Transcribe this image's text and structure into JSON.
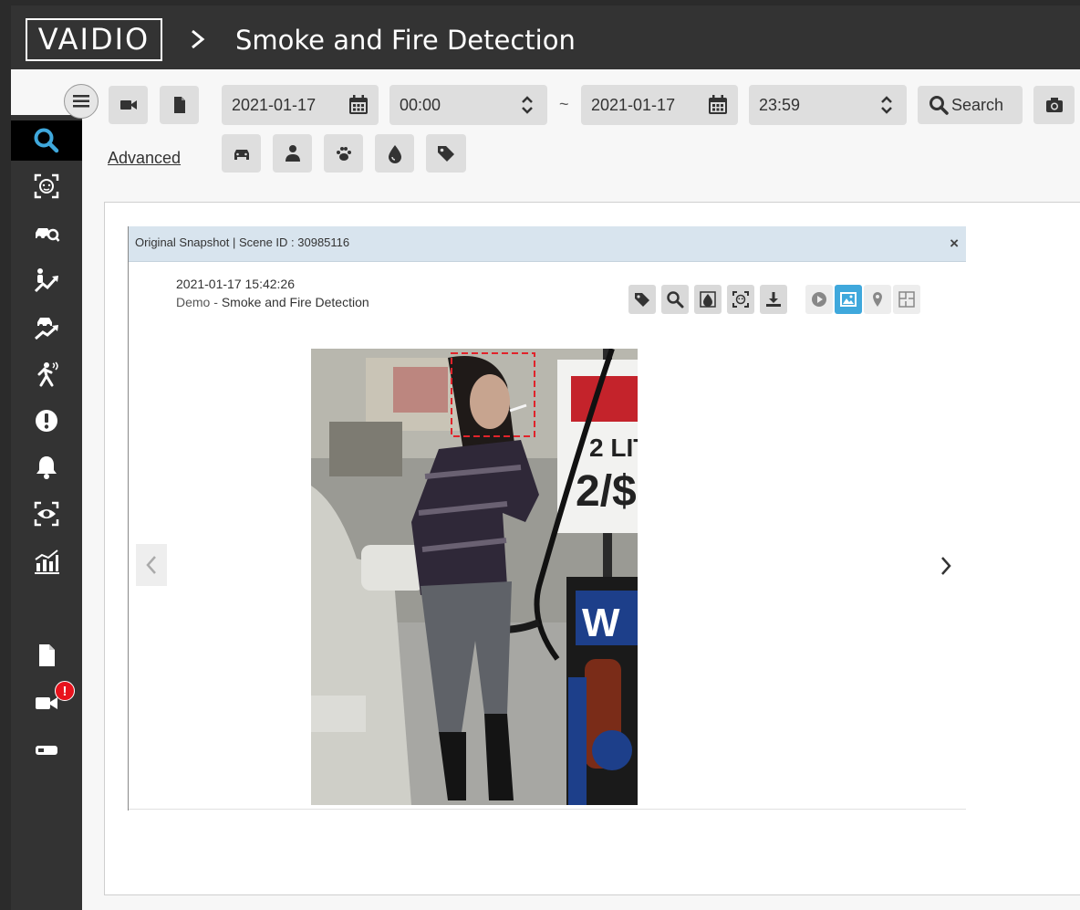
{
  "app": {
    "logo": "VAIDIO",
    "page_title": "Smoke and Fire Detection"
  },
  "toolbar": {
    "start_date": "2021-01-17",
    "start_time": "00:00",
    "range_sep": "~",
    "end_date": "2021-01-17",
    "end_time": "23:59",
    "search_label": "Search",
    "advanced_label": "Advanced"
  },
  "sidebar": {
    "items": [
      {
        "icon": "search-icon",
        "active": true
      },
      {
        "icon": "face-scan-icon"
      },
      {
        "icon": "vehicle-search-icon"
      },
      {
        "icon": "person-trend-icon"
      },
      {
        "icon": "vehicle-trend-icon"
      },
      {
        "icon": "fall-detection-icon"
      },
      {
        "icon": "alert-icon"
      },
      {
        "icon": "bell-icon"
      },
      {
        "icon": "eye-scan-icon"
      },
      {
        "icon": "analytics-icon"
      },
      {
        "icon": "file-icon"
      },
      {
        "icon": "camera-icon",
        "badge": "!"
      },
      {
        "icon": "device-icon"
      }
    ]
  },
  "snapshot": {
    "title": "Original Snapshot | Scene ID : 30985116",
    "close_label": "×",
    "timestamp": "2021-01-17 15:42:26",
    "camera_prefix": "Demo",
    "camera_sep": " - ",
    "camera_name": "Smoke and Fire Detection"
  },
  "colors": {
    "header": "#333333",
    "active_action": "#3fa8dc",
    "badge": "#e8131d",
    "detection_box": "#e0242b"
  }
}
